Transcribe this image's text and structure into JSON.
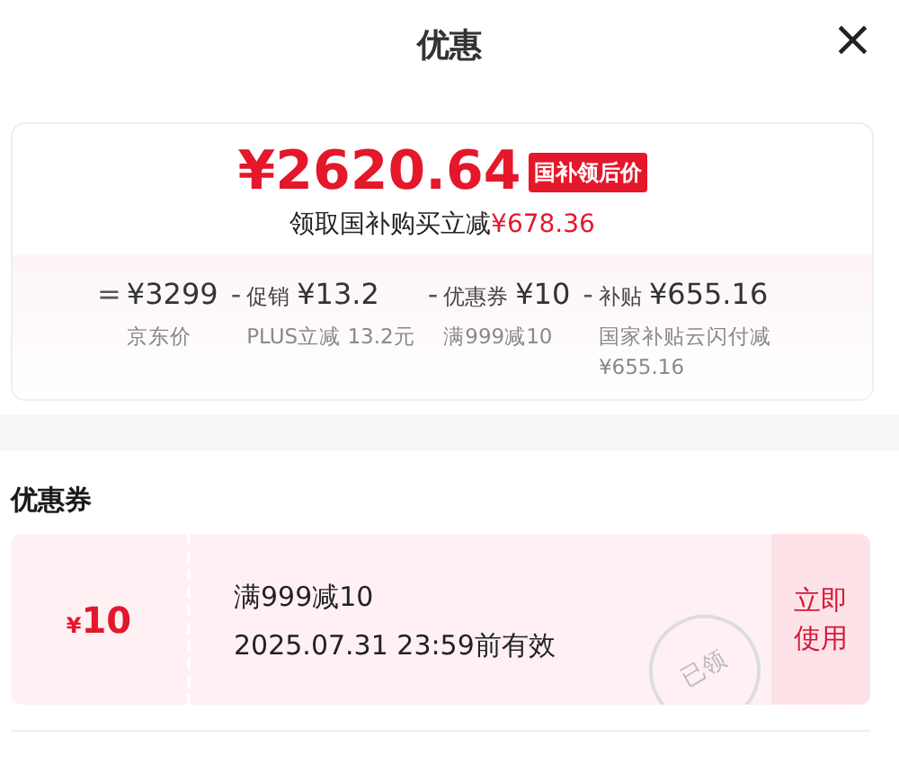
{
  "header": {
    "title": "优惠",
    "close": "×"
  },
  "price": {
    "amount": "¥2620.64",
    "tag": "国补领后价",
    "subtitle": "领取国补购买立减",
    "saving": "¥678.36"
  },
  "breakdown": [
    {
      "op": "=",
      "amount": "¥3299",
      "desc": "京东价"
    },
    {
      "op": "-",
      "label": "促销",
      "amount": "¥13.2",
      "desc": "PLUS立减 13.2元"
    },
    {
      "op": "-",
      "label": "优惠券",
      "amount": "¥10",
      "desc": "满999减10"
    },
    {
      "op": "-",
      "label": "补贴",
      "amount": "¥655.16",
      "desc": "国家补贴云闪付减¥655.16"
    }
  ],
  "coupons_section": {
    "title": "优惠券"
  },
  "coupons": [
    {
      "currency": "¥",
      "value": "10",
      "condition": "满999减10",
      "validity": "2025.07.31 23:59前有效",
      "stamp": "已领",
      "action": "立即使用"
    }
  ]
}
